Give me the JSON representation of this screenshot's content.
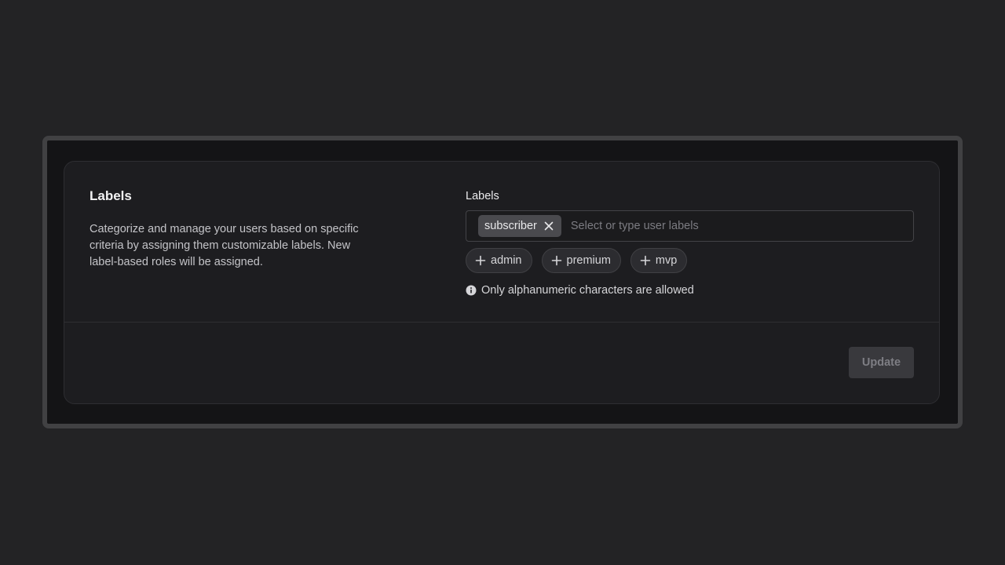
{
  "section": {
    "title": "Labels",
    "description": "Categorize and manage your users based on specific criteria by assigning them customizable labels. New label-based roles will be assigned."
  },
  "field": {
    "label": "Labels",
    "placeholder": "Select or type user labels",
    "selected_tags": [
      {
        "label": "subscriber",
        "remove_icon": "close-icon"
      }
    ],
    "suggestions": [
      {
        "label": "admin",
        "icon": "plus-icon"
      },
      {
        "label": "premium",
        "icon": "plus-icon"
      },
      {
        "label": "mvp",
        "icon": "plus-icon"
      }
    ],
    "hint": "Only alphanumeric characters are allowed",
    "hint_icon": "info-icon"
  },
  "actions": {
    "update_label": "Update",
    "update_disabled": true
  },
  "colors": {
    "background": "#232325",
    "frame_border": "#414143",
    "card": "#1d1d20",
    "tag": "#4a4a4e",
    "button_disabled": "#39393d"
  }
}
